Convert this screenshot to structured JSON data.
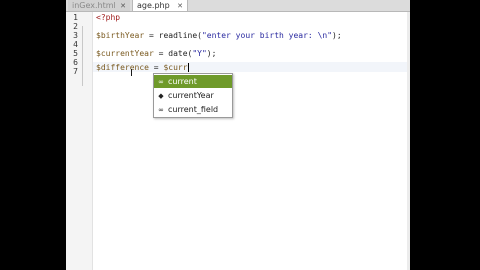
{
  "tabs": [
    {
      "label": "inGex.html",
      "active": false,
      "close": "✕"
    },
    {
      "label": "age.php",
      "active": true,
      "close": "✕"
    }
  ],
  "line_numbers": [
    "1",
    "2",
    "3",
    "4",
    "5",
    "6",
    "7"
  ],
  "code": {
    "l1": "<?php",
    "l3_var": "$birthYear",
    "l3_rest": " = readline(",
    "l3_str": "\"enter your birth year: \\n\"",
    "l3_end": ");",
    "l5_var": "$currentYear",
    "l5_rest": " = date(",
    "l5_str": "\"Y\"",
    "l5_end": ");",
    "l7_var": "$difference",
    "l7_rest": " = ",
    "l7_var2": "$curr"
  },
  "autocomplete": [
    {
      "label": "current",
      "icon": "field-icon",
      "selected": true
    },
    {
      "label": "currentYear",
      "icon": "variable-icon",
      "selected": false
    },
    {
      "label": "current_field",
      "icon": "field-icon",
      "selected": false
    }
  ],
  "colors": {
    "selection": "#6f9a2a",
    "keyword": "#a02020",
    "variable": "#7a5a20",
    "string": "#2a2aa0"
  }
}
